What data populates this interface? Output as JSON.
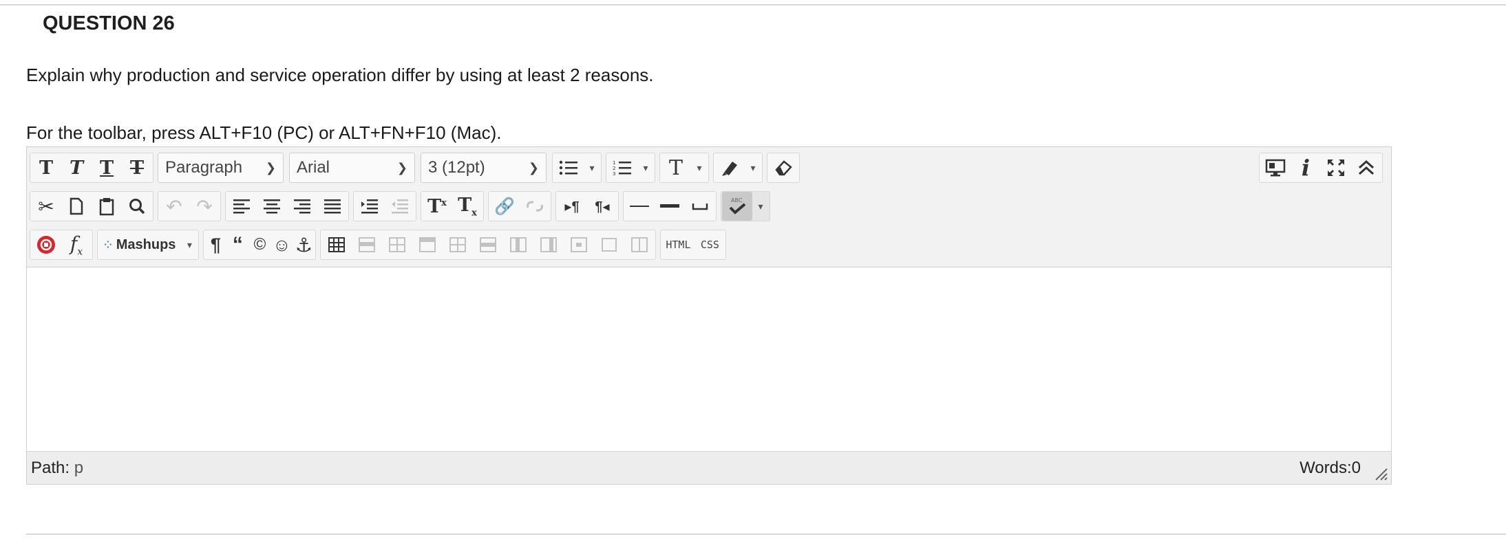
{
  "question": {
    "title": "QUESTION 26",
    "text": "Explain why production and service operation differ by using at least 2 reasons."
  },
  "editor": {
    "toolbar_hint": "For the toolbar, press ALT+F10 (PC) or ALT+FN+F10 (Mac).",
    "paragraph_select": "Paragraph",
    "font_select": "Arial",
    "size_select": "3 (12pt)",
    "mashups_label": "Mashups",
    "html_label": "HTML",
    "css_label": "CSS",
    "status": {
      "path_label": "Path:",
      "path_value": "p",
      "words": "Words:0"
    },
    "content": ""
  }
}
